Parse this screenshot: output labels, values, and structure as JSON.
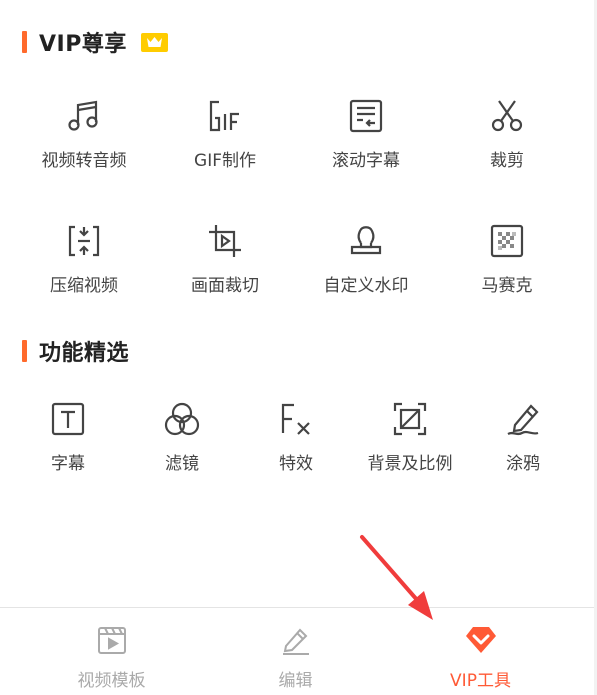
{
  "sections": {
    "vip": {
      "title": "VIP尊享",
      "badge_icon": "crown-icon"
    },
    "features": {
      "title": "功能精选"
    }
  },
  "vip_tools": [
    {
      "label": "视频转音频",
      "icon": "music-note-icon"
    },
    {
      "label": "GIF制作",
      "icon": "gif-icon"
    },
    {
      "label": "滚动字幕",
      "icon": "scroll-subtitle-icon"
    },
    {
      "label": "裁剪",
      "icon": "scissors-icon"
    },
    {
      "label": "压缩视频",
      "icon": "compress-icon"
    },
    {
      "label": "画面裁切",
      "icon": "crop-icon"
    },
    {
      "label": "自定义水印",
      "icon": "stamp-icon"
    },
    {
      "label": "马赛克",
      "icon": "mosaic-icon"
    }
  ],
  "feature_tools": [
    {
      "label": "字幕",
      "icon": "text-box-icon"
    },
    {
      "label": "滤镜",
      "icon": "filter-circles-icon"
    },
    {
      "label": "特效",
      "icon": "fx-icon"
    },
    {
      "label": "背景及比例",
      "icon": "aspect-ratio-icon"
    },
    {
      "label": "涂鸦",
      "icon": "pen-icon"
    }
  ],
  "tabbar": {
    "tabs": [
      {
        "label": "视频模板",
        "icon": "video-template-icon",
        "active": false
      },
      {
        "label": "编辑",
        "icon": "edit-pencil-icon",
        "active": false
      },
      {
        "label": "VIP工具",
        "icon": "vip-chevron-icon",
        "active": true
      }
    ]
  },
  "colors": {
    "accent": "#ff6a2c",
    "active_tab": "#ff5a36",
    "inactive_tab": "#aaaaaa",
    "crown_bg": "#ffcc00",
    "arrow": "#f03c3c"
  }
}
